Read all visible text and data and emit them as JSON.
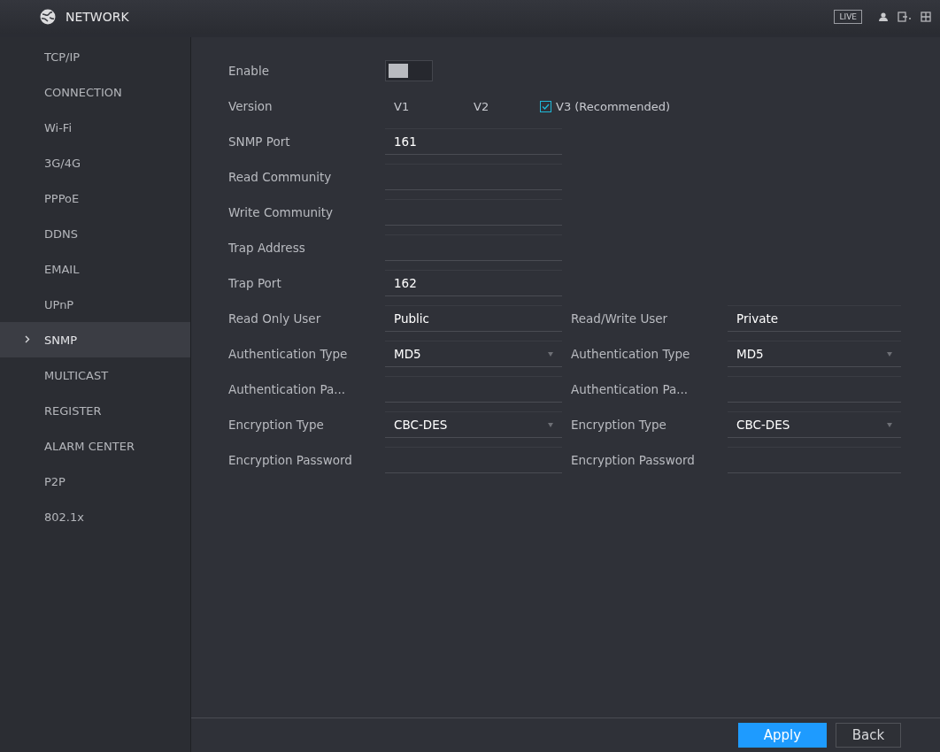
{
  "header": {
    "title": "NETWORK",
    "live_button": "LIVE"
  },
  "sidebar": {
    "items": [
      {
        "label": "TCP/IP",
        "selected": false
      },
      {
        "label": "CONNECTION",
        "selected": false
      },
      {
        "label": "Wi-Fi",
        "selected": false
      },
      {
        "label": "3G/4G",
        "selected": false
      },
      {
        "label": "PPPoE",
        "selected": false
      },
      {
        "label": "DDNS",
        "selected": false
      },
      {
        "label": "EMAIL",
        "selected": false
      },
      {
        "label": "UPnP",
        "selected": false
      },
      {
        "label": "SNMP",
        "selected": true
      },
      {
        "label": "MULTICAST",
        "selected": false
      },
      {
        "label": "REGISTER",
        "selected": false
      },
      {
        "label": "ALARM CENTER",
        "selected": false
      },
      {
        "label": "P2P",
        "selected": false
      },
      {
        "label": "802.1x",
        "selected": false
      }
    ]
  },
  "form": {
    "enable": {
      "label": "Enable",
      "on": false
    },
    "version": {
      "label": "Version",
      "options": [
        {
          "label": "V1",
          "checked": false
        },
        {
          "label": "V2",
          "checked": false
        },
        {
          "label": "V3 (Recommended)",
          "checked": true
        }
      ]
    },
    "fields": [
      {
        "label": "SNMP Port",
        "value": "161"
      },
      {
        "label": "Read Community"
      },
      {
        "label": "Write Community"
      },
      {
        "label": "Trap Address"
      },
      {
        "label": "Trap Port",
        "value": "162"
      }
    ],
    "pairs": [
      {
        "left": {
          "label": "Read Only User",
          "kind": "text",
          "value": "Public"
        },
        "right": {
          "label": "Read/Write User",
          "kind": "text",
          "value": "Private"
        }
      },
      {
        "left": {
          "label": "Authentication Type",
          "kind": "select",
          "value": "MD5"
        },
        "right": {
          "label": "Authentication Type",
          "kind": "select",
          "value": "MD5"
        }
      },
      {
        "left": {
          "label": "Authentication Pa...",
          "kind": "text"
        },
        "right": {
          "label": "Authentication Pa...",
          "kind": "text"
        }
      },
      {
        "left": {
          "label": "Encryption Type",
          "kind": "select",
          "value": "CBC-DES"
        },
        "right": {
          "label": "Encryption Type",
          "kind": "select",
          "value": "CBC-DES"
        }
      },
      {
        "left": {
          "label": "Encryption Password",
          "kind": "text"
        },
        "right": {
          "label": "Encryption Password",
          "kind": "text"
        }
      }
    ]
  },
  "buttons": [
    {
      "label": "Apply",
      "primary": true
    },
    {
      "label": "Back",
      "primary": false
    }
  ]
}
